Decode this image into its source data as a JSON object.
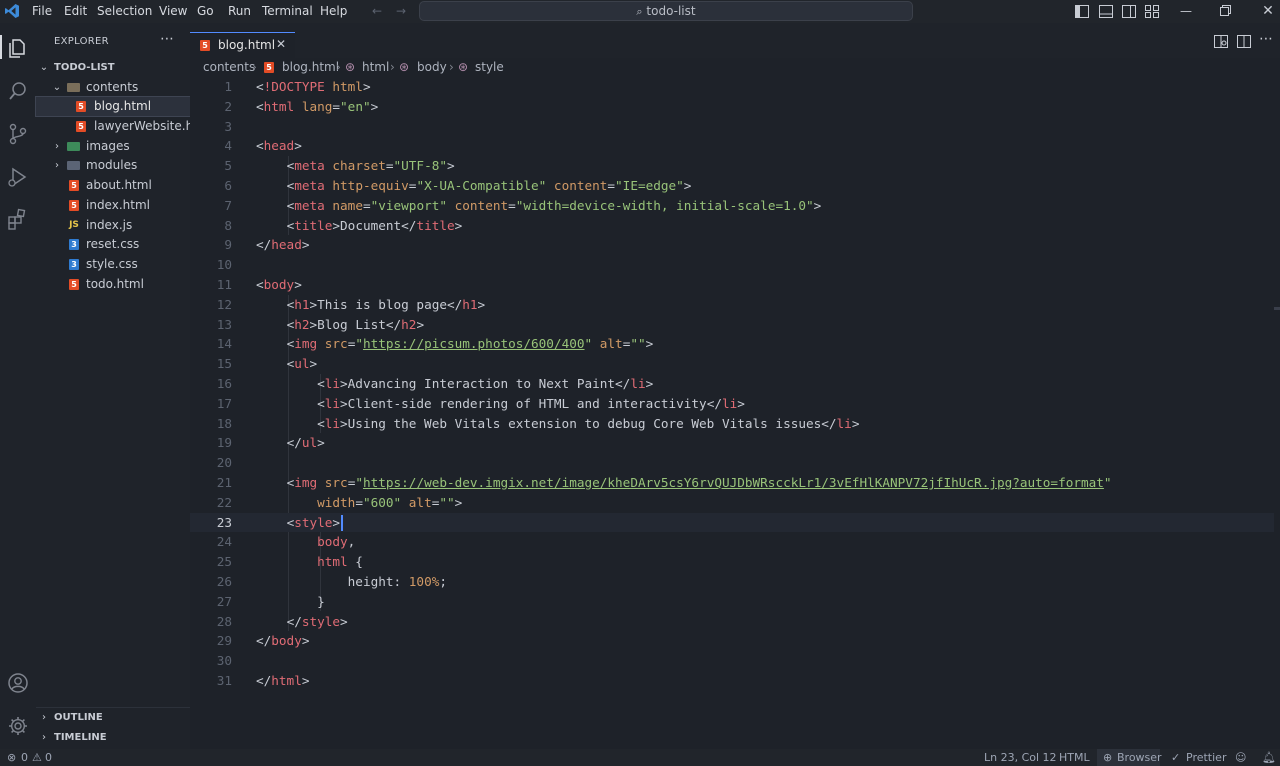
{
  "menu": [
    "File",
    "Edit",
    "Selection",
    "View",
    "Go",
    "Run",
    "Terminal",
    "Help"
  ],
  "command_center": "todo-list",
  "explorer": {
    "header": "EXPLORER",
    "project": "TODO-LIST",
    "items": [
      {
        "label": "contents",
        "type": "folder-open"
      },
      {
        "label": "blog.html",
        "type": "html",
        "selected": true
      },
      {
        "label": "lawyerWebsite.h...",
        "type": "html"
      },
      {
        "label": "images",
        "type": "folder-img"
      },
      {
        "label": "modules",
        "type": "folder"
      },
      {
        "label": "about.html",
        "type": "html"
      },
      {
        "label": "index.html",
        "type": "html"
      },
      {
        "label": "index.js",
        "type": "js"
      },
      {
        "label": "reset.css",
        "type": "css"
      },
      {
        "label": "style.css",
        "type": "css"
      },
      {
        "label": "todo.html",
        "type": "html"
      }
    ],
    "outline": "OUTLINE",
    "timeline": "TIMELINE"
  },
  "tab": {
    "label": "blog.html"
  },
  "breadcrumbs": [
    "contents",
    "blog.html",
    "html",
    "body",
    "style"
  ],
  "code": [
    [
      [
        "t-br",
        "<"
      ],
      [
        "t-tag",
        "!DOCTYPE"
      ],
      [
        "t-attr",
        " html"
      ],
      [
        "t-br",
        ">"
      ]
    ],
    [
      [
        "t-br",
        "<"
      ],
      [
        "t-tag",
        "html"
      ],
      [
        "t-attr",
        " lang"
      ],
      [
        "t-br",
        "="
      ],
      [
        "t-str",
        "\"en\""
      ],
      [
        "t-br",
        ">"
      ]
    ],
    [],
    [
      [
        "t-br",
        "<"
      ],
      [
        "t-tag",
        "head"
      ],
      [
        "t-br",
        ">"
      ]
    ],
    [
      [
        "t-txt",
        "    "
      ],
      [
        "t-br",
        "<"
      ],
      [
        "t-tag",
        "meta"
      ],
      [
        "t-attr",
        " charset"
      ],
      [
        "t-br",
        "="
      ],
      [
        "t-str",
        "\"UTF-8\""
      ],
      [
        "t-br",
        ">"
      ]
    ],
    [
      [
        "t-txt",
        "    "
      ],
      [
        "t-br",
        "<"
      ],
      [
        "t-tag",
        "meta"
      ],
      [
        "t-attr",
        " http-equiv"
      ],
      [
        "t-br",
        "="
      ],
      [
        "t-str",
        "\"X-UA-Compatible\""
      ],
      [
        "t-attr",
        " content"
      ],
      [
        "t-br",
        "="
      ],
      [
        "t-str",
        "\"IE=edge\""
      ],
      [
        "t-br",
        ">"
      ]
    ],
    [
      [
        "t-txt",
        "    "
      ],
      [
        "t-br",
        "<"
      ],
      [
        "t-tag",
        "meta"
      ],
      [
        "t-attr",
        " name"
      ],
      [
        "t-br",
        "="
      ],
      [
        "t-str",
        "\"viewport\""
      ],
      [
        "t-attr",
        " content"
      ],
      [
        "t-br",
        "="
      ],
      [
        "t-str",
        "\"width=device-width, initial-scale=1.0\""
      ],
      [
        "t-br",
        ">"
      ]
    ],
    [
      [
        "t-txt",
        "    "
      ],
      [
        "t-br",
        "<"
      ],
      [
        "t-tag",
        "title"
      ],
      [
        "t-br",
        ">"
      ],
      [
        "t-txt",
        "Document"
      ],
      [
        "t-br",
        "</"
      ],
      [
        "t-tag",
        "title"
      ],
      [
        "t-br",
        ">"
      ]
    ],
    [
      [
        "t-br",
        "</"
      ],
      [
        "t-tag",
        "head"
      ],
      [
        "t-br",
        ">"
      ]
    ],
    [],
    [
      [
        "t-br",
        "<"
      ],
      [
        "t-tag",
        "body"
      ],
      [
        "t-br",
        ">"
      ]
    ],
    [
      [
        "t-txt",
        "    "
      ],
      [
        "t-br",
        "<"
      ],
      [
        "t-tag",
        "h1"
      ],
      [
        "t-br",
        ">"
      ],
      [
        "t-txt",
        "This is blog page"
      ],
      [
        "t-br",
        "</"
      ],
      [
        "t-tag",
        "h1"
      ],
      [
        "t-br",
        ">"
      ]
    ],
    [
      [
        "t-txt",
        "    "
      ],
      [
        "t-br",
        "<"
      ],
      [
        "t-tag",
        "h2"
      ],
      [
        "t-br",
        ">"
      ],
      [
        "t-txt",
        "Blog List"
      ],
      [
        "t-br",
        "</"
      ],
      [
        "t-tag",
        "h2"
      ],
      [
        "t-br",
        ">"
      ]
    ],
    [
      [
        "t-txt",
        "    "
      ],
      [
        "t-br",
        "<"
      ],
      [
        "t-tag",
        "img"
      ],
      [
        "t-attr",
        " src"
      ],
      [
        "t-br",
        "="
      ],
      [
        "t-str",
        "\""
      ],
      [
        "t-url",
        "https://picsum.photos/600/400"
      ],
      [
        "t-str",
        "\""
      ],
      [
        "t-attr",
        " alt"
      ],
      [
        "t-br",
        "="
      ],
      [
        "t-str",
        "\"\""
      ],
      [
        "t-br",
        ">"
      ]
    ],
    [
      [
        "t-txt",
        "    "
      ],
      [
        "t-br",
        "<"
      ],
      [
        "t-tag",
        "ul"
      ],
      [
        "t-br",
        ">"
      ]
    ],
    [
      [
        "t-txt",
        "        "
      ],
      [
        "t-br",
        "<"
      ],
      [
        "t-tag",
        "li"
      ],
      [
        "t-br",
        ">"
      ],
      [
        "t-txt",
        "Advancing Interaction to Next Paint"
      ],
      [
        "t-br",
        "</"
      ],
      [
        "t-tag",
        "li"
      ],
      [
        "t-br",
        ">"
      ]
    ],
    [
      [
        "t-txt",
        "        "
      ],
      [
        "t-br",
        "<"
      ],
      [
        "t-tag",
        "li"
      ],
      [
        "t-br",
        ">"
      ],
      [
        "t-txt",
        "Client-side rendering of HTML and interactivity"
      ],
      [
        "t-br",
        "</"
      ],
      [
        "t-tag",
        "li"
      ],
      [
        "t-br",
        ">"
      ]
    ],
    [
      [
        "t-txt",
        "        "
      ],
      [
        "t-br",
        "<"
      ],
      [
        "t-tag",
        "li"
      ],
      [
        "t-br",
        ">"
      ],
      [
        "t-txt",
        "Using the Web Vitals extension to debug Core Web Vitals issues"
      ],
      [
        "t-br",
        "</"
      ],
      [
        "t-tag",
        "li"
      ],
      [
        "t-br",
        ">"
      ]
    ],
    [
      [
        "t-txt",
        "    "
      ],
      [
        "t-br",
        "</"
      ],
      [
        "t-tag",
        "ul"
      ],
      [
        "t-br",
        ">"
      ]
    ],
    [],
    [
      [
        "t-txt",
        "    "
      ],
      [
        "t-br",
        "<"
      ],
      [
        "t-tag",
        "img"
      ],
      [
        "t-attr",
        " src"
      ],
      [
        "t-br",
        "="
      ],
      [
        "t-str",
        "\""
      ],
      [
        "t-url",
        "https://web-dev.imgix.net/image/kheDArv5csY6rvQUJDbWRscckLr1/3vEfHlKANPV72jfIhUcR.jpg?auto=format"
      ],
      [
        "t-str",
        "\""
      ]
    ],
    [
      [
        "t-txt",
        "        "
      ],
      [
        "t-attr",
        "width"
      ],
      [
        "t-br",
        "="
      ],
      [
        "t-str",
        "\"600\""
      ],
      [
        "t-attr",
        " alt"
      ],
      [
        "t-br",
        "="
      ],
      [
        "t-str",
        "\"\""
      ],
      [
        "t-br",
        ">"
      ]
    ],
    [
      [
        "t-txt",
        "    "
      ],
      [
        "t-br",
        "<"
      ],
      [
        "t-tag",
        "style"
      ],
      [
        "t-br",
        ">"
      ]
    ],
    [
      [
        "t-txt",
        "        "
      ],
      [
        "t-tag",
        "body"
      ],
      [
        "t-br",
        ","
      ]
    ],
    [
      [
        "t-txt",
        "        "
      ],
      [
        "t-tag",
        "html"
      ],
      [
        "t-br",
        " {"
      ]
    ],
    [
      [
        "t-txt",
        "            "
      ],
      [
        "t-prop",
        "height"
      ],
      [
        "t-br",
        ": "
      ],
      [
        "t-num",
        "100%"
      ],
      [
        "t-br",
        ";"
      ]
    ],
    [
      [
        "t-txt",
        "        "
      ],
      [
        "t-br",
        "}"
      ]
    ],
    [
      [
        "t-txt",
        "    "
      ],
      [
        "t-br",
        "</"
      ],
      [
        "t-tag",
        "style"
      ],
      [
        "t-br",
        ">"
      ]
    ],
    [
      [
        "t-br",
        "</"
      ],
      [
        "t-tag",
        "body"
      ],
      [
        "t-br",
        ">"
      ]
    ],
    [],
    [
      [
        "t-br",
        "</"
      ],
      [
        "t-tag",
        "html"
      ],
      [
        "t-br",
        ">"
      ]
    ]
  ],
  "cursor_line": 23,
  "status": {
    "errors": "0",
    "warnings": "0",
    "position": "Ln 23, Col 12",
    "language": "HTML",
    "browser": "Browser",
    "prettier": "Prettier"
  },
  "colors": {
    "accent": "#528bff",
    "html_icon": "#e34c26",
    "css_icon": "#2f7bd0",
    "js_icon": "#e8c64a"
  }
}
